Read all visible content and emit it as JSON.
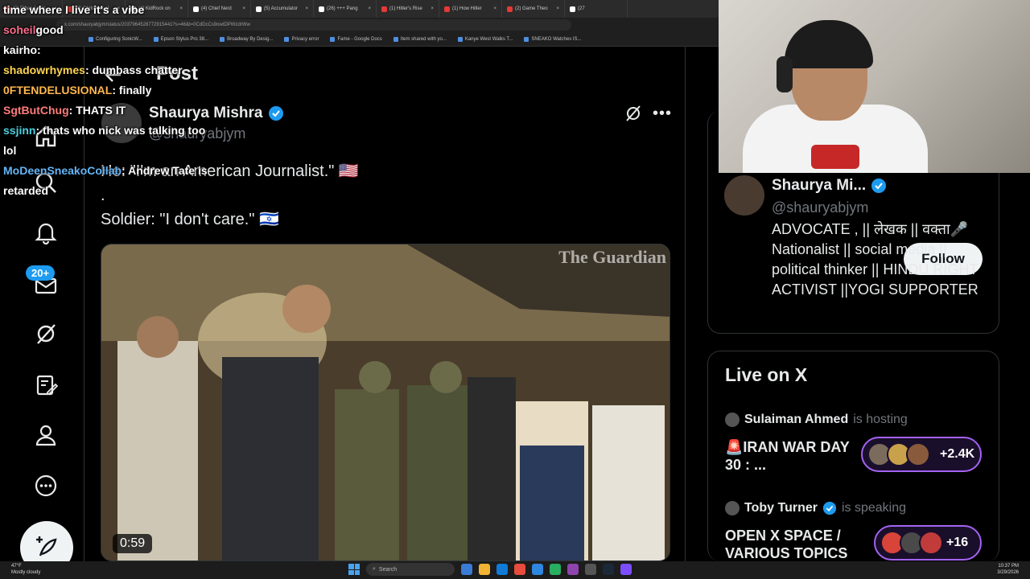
{
  "browser": {
    "tabs": [
      "(2) Ethan Levin",
      "(4) Chris Menai",
      "(4) KidRock on",
      "(4) Chief Nerd",
      "(5) Accumulator",
      "(26) +++ Pang",
      "(1) Hitler's Rise",
      "(1) How Hitler",
      "(2) Game Theo",
      "(27"
    ],
    "url": "x.com/shauryabjym/status/2037964528772915441?s=46&t=0CdDcCs9owtDPWzdrWw",
    "bookmarks": [
      "Configuring SonicW...",
      "Epson Stylus Pro 38...",
      "Broadway By Desig...",
      "Privacy error",
      "Fame - Google Docs",
      "Item shared with yo...",
      "Kanye West Walks T...",
      "SNEAKO Watches IS..."
    ]
  },
  "chat": [
    {
      "user": "",
      "msg": "time where I live it's a vibe"
    },
    {
      "user": "soheil",
      "msg": "good"
    },
    {
      "user": "kairho",
      "msg": ""
    },
    {
      "user": "shadowrhymes",
      "msg": "dumbass chatter"
    },
    {
      "user": "0FTENDELUSIONAL",
      "msg": "finally"
    },
    {
      "user": "SgtButChug",
      "msg": "THATS IT"
    },
    {
      "user": "ssjinn",
      "msg": "thats who nick was talking too lol"
    },
    {
      "user": "MoDeenSneakoCollab",
      "msg": "Andrew Tate is retarded"
    }
  ],
  "nav": {
    "notification_badge": "20+"
  },
  "main": {
    "header_title": "Post",
    "author_name": "Shaurya Mishra",
    "author_handle": "@shauryabjym",
    "tweet_lines": [
      "He: \"I'm an American Journalist.\" 🇺🇸",
      ".",
      "Soldier: \"I don't care.\" 🇮🇱"
    ],
    "video_duration": "0:59",
    "watermark": "The Guardian"
  },
  "right": {
    "profile": {
      "name": "Shaurya Mi...",
      "handle": "@shauryabjym",
      "follow_label": "Follow",
      "bio": "ADVOCATE , || लेखक || वक्ता🎤 Nationalist || social media || political thinker || HINDU RIGHT ACTIVIST ||YOGI SUPPORTER"
    },
    "live": {
      "title": "Live on X",
      "spaces": [
        {
          "host": "Sulaiman Ahmed",
          "status": "is hosting",
          "title": "🚨IRAN WAR DAY 30 : ...",
          "count": "+2.4K"
        },
        {
          "host": "Toby Turner",
          "status": "is speaking",
          "title": "OPEN X SPACE / VARIOUS TOPICS",
          "count": "+16"
        }
      ]
    }
  },
  "taskbar": {
    "weather_temp": "47°F",
    "weather_desc": "Mostly cloudy",
    "search_placeholder": "Search",
    "time": "10:37 PM",
    "date": "3/29/2026"
  },
  "colors": {
    "accent": "#1d9bf0",
    "live_ring": "#a463f2",
    "background": "#000000"
  }
}
